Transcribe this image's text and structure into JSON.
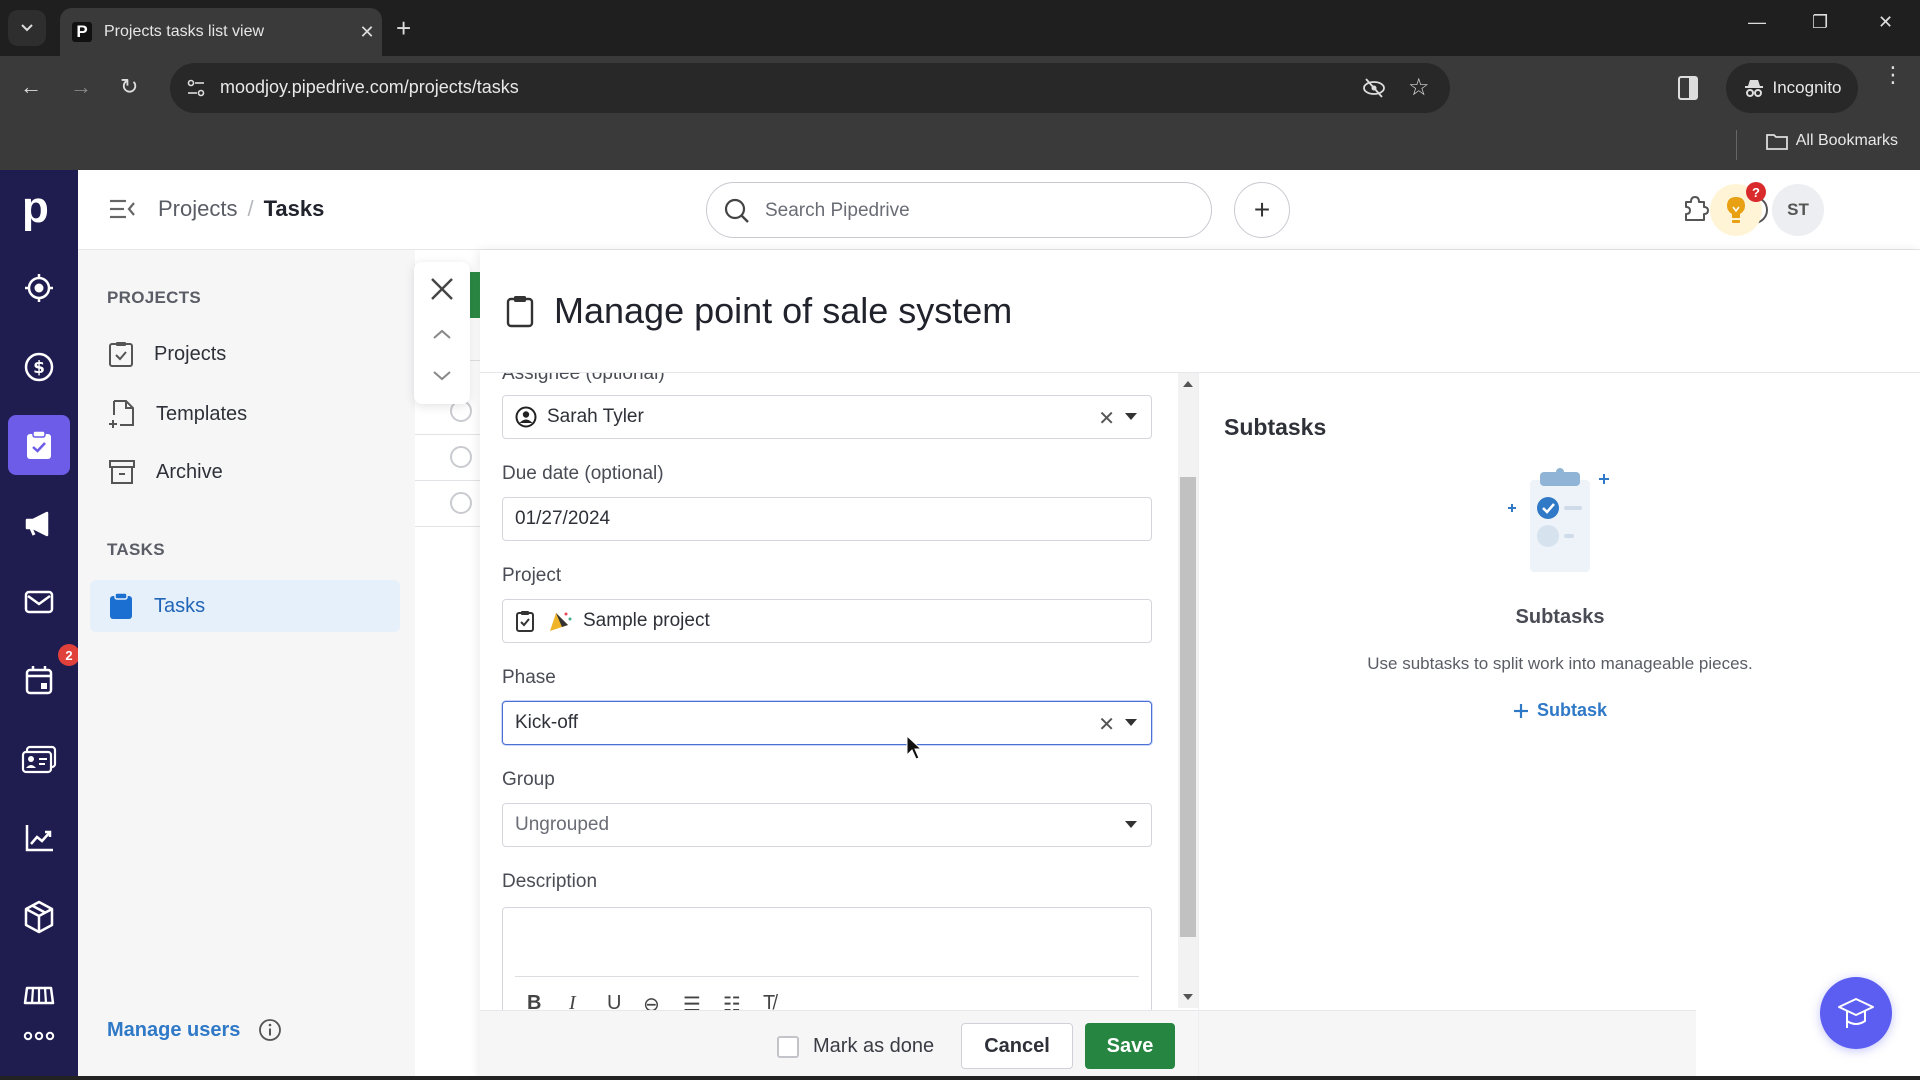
{
  "browser": {
    "tab_title": "Projects tasks list view",
    "tab_favicon": "P",
    "url": "moodjoy.pipedrive.com/projects/tasks",
    "incognito_label": "Incognito",
    "all_bookmarks_label": "All Bookmarks"
  },
  "header": {
    "breadcrumb": [
      "Projects",
      "Tasks"
    ],
    "breadcrumb_separator": "/",
    "search_placeholder": "Search Pipedrive",
    "add_label": "+",
    "avatar_initials": "ST",
    "tips_badge": "?"
  },
  "rail": {
    "logo": "p",
    "items": [
      {
        "name": "leads",
        "icon": "target-icon"
      },
      {
        "name": "deals",
        "icon": "dollar-icon"
      },
      {
        "name": "projects",
        "icon": "clipboard-check-icon",
        "active": true
      },
      {
        "name": "campaigns",
        "icon": "megaphone-icon"
      },
      {
        "name": "mail",
        "icon": "mail-icon"
      },
      {
        "name": "activities",
        "icon": "calendar-icon",
        "badge": "2"
      },
      {
        "name": "contacts",
        "icon": "contact-card-icon"
      },
      {
        "name": "insights",
        "icon": "chart-icon"
      },
      {
        "name": "products",
        "icon": "box-icon"
      },
      {
        "name": "marketplace",
        "icon": "store-icon"
      },
      {
        "name": "more",
        "icon": "more-icon"
      }
    ]
  },
  "sidebar": {
    "sections": [
      {
        "heading": "PROJECTS",
        "items": [
          {
            "label": "Projects",
            "icon": "clipboard-check-icon"
          },
          {
            "label": "Templates",
            "icon": "template-icon"
          },
          {
            "label": "Archive",
            "icon": "archive-icon"
          }
        ]
      },
      {
        "heading": "TASKS",
        "items": [
          {
            "label": "Tasks",
            "icon": "clipboard-icon",
            "active": true
          }
        ]
      }
    ],
    "manage_users_label": "Manage users"
  },
  "modal": {
    "title": "Manage point of sale system",
    "fields": {
      "assignee": {
        "label": "Assignee (optional)",
        "value": "Sarah Tyler"
      },
      "due_date": {
        "label": "Due date (optional)",
        "value": "01/27/2024"
      },
      "project": {
        "label": "Project",
        "value": "Sample project"
      },
      "phase": {
        "label": "Phase",
        "value": "Kick-off"
      },
      "group": {
        "label": "Group",
        "value": "Ungrouped"
      },
      "description": {
        "label": "Description",
        "value": ""
      }
    },
    "rich_text_toolbar": [
      "B",
      "I",
      "U",
      "link",
      "bullet-list",
      "numbered-list",
      "clear-format"
    ],
    "footer": {
      "mark_as_done_label": "Mark as done",
      "mark_as_done_checked": false,
      "cancel_label": "Cancel",
      "save_label": "Save"
    },
    "subtasks": {
      "title": "Subtasks",
      "empty_title": "Subtasks",
      "empty_description": "Use subtasks to split work into manageable pieces.",
      "add_label": "Subtask"
    }
  },
  "colors": {
    "rail_bg": "#1f1c4f",
    "rail_active": "#6c5ce7",
    "save_green": "#258541",
    "link_blue": "#2f79c7",
    "academy_button": "#5b5ef0"
  }
}
